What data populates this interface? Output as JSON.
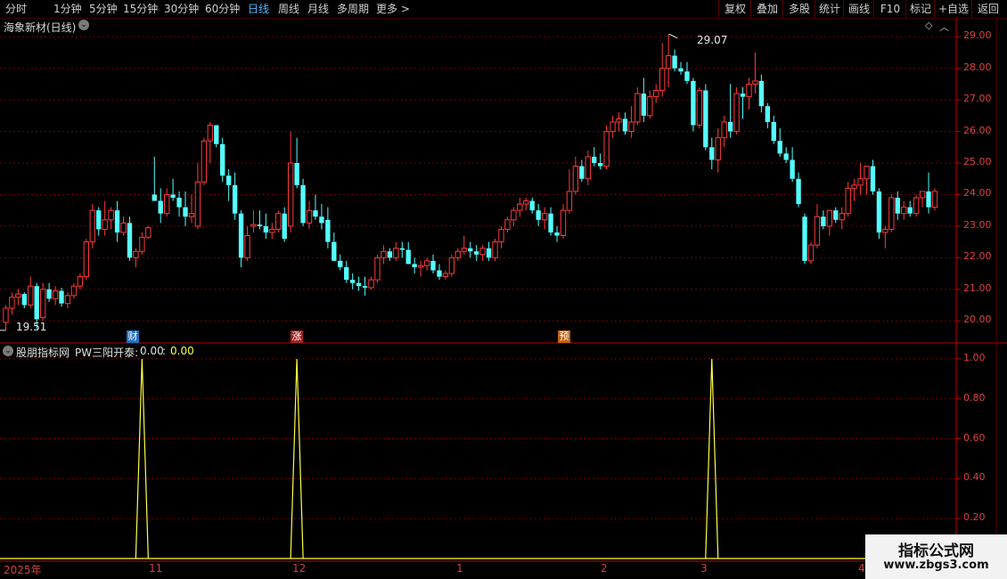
{
  "toolbar": {
    "periods": [
      "分时",
      "1分钟",
      "5分钟",
      "15分钟",
      "30分钟",
      "60分钟",
      "日线",
      "周线",
      "月线",
      "多周期",
      "更多 >"
    ],
    "selected_period": "日线",
    "actions": [
      "复权",
      "叠加",
      "多股",
      "统计",
      "画线",
      "F10",
      "标记",
      "+自选",
      "返回"
    ]
  },
  "main_chart": {
    "title": "海象新材(日线)",
    "high_label": "29.07",
    "low_label": "19.51",
    "markers": [
      "财",
      "涨",
      "预"
    ]
  },
  "indicator": {
    "name": "股朋指标网",
    "formula": "PW三阳开泰:",
    "value1": "0.00",
    "value2": "0.00"
  },
  "time_axis": [
    "2025年",
    "11",
    "12",
    "1",
    "2",
    "3",
    "4"
  ],
  "watermark": {
    "line1": "指标公式网",
    "line2": "www.zbgs3.com"
  },
  "chart_data": [
    {
      "type": "candlestick",
      "title": "海象新材(日线)",
      "ylim": [
        19.3,
        29.6
      ],
      "y_ticks": [
        20.0,
        21.0,
        22.0,
        23.0,
        24.0,
        25.0,
        26.0,
        27.0,
        28.0,
        29.0
      ],
      "up_color": "#ff3a3a",
      "down_color": "#54ffff",
      "candles": [
        [
          19.95,
          20.5,
          19.7,
          20.4
        ],
        [
          20.4,
          20.9,
          20.2,
          20.75
        ],
        [
          20.75,
          21.0,
          20.5,
          20.85
        ],
        [
          20.85,
          20.9,
          20.4,
          20.5
        ],
        [
          20.5,
          21.4,
          20.4,
          21.1
        ],
        [
          21.1,
          21.2,
          19.75,
          20.05
        ],
        [
          20.1,
          21.2,
          20.0,
          21.0
        ],
        [
          21.0,
          21.2,
          20.6,
          20.7
        ],
        [
          20.7,
          21.1,
          20.5,
          20.95
        ],
        [
          20.95,
          21.05,
          20.45,
          20.55
        ],
        [
          20.55,
          20.9,
          20.4,
          20.8
        ],
        [
          20.8,
          21.2,
          20.7,
          21.1
        ],
        [
          21.1,
          21.5,
          21.0,
          21.4
        ],
        [
          21.4,
          22.6,
          21.3,
          22.5
        ],
        [
          22.5,
          23.7,
          22.3,
          23.5
        ],
        [
          23.5,
          23.6,
          22.7,
          22.9
        ],
        [
          22.9,
          23.8,
          22.7,
          23.2
        ],
        [
          23.2,
          23.6,
          22.9,
          23.5
        ],
        [
          23.5,
          23.8,
          22.5,
          22.8
        ],
        [
          22.8,
          23.3,
          22.7,
          23.1
        ],
        [
          23.1,
          23.3,
          21.9,
          22.0
        ],
        [
          22.0,
          22.3,
          21.7,
          22.2
        ],
        [
          22.2,
          22.8,
          22.1,
          22.65
        ],
        [
          22.65,
          23.0,
          22.6,
          22.95
        ],
        [
          24.0,
          25.2,
          23.8,
          23.8
        ],
        [
          23.8,
          24.2,
          23.1,
          23.4
        ],
        [
          23.4,
          24.2,
          23.3,
          24.0
        ],
        [
          24.0,
          24.5,
          23.8,
          23.9
        ],
        [
          23.9,
          24.1,
          23.3,
          23.6
        ],
        [
          23.6,
          24.1,
          23.0,
          23.3
        ],
        [
          23.3,
          24.0,
          23.1,
          23.4
        ],
        [
          23.0,
          25.0,
          22.9,
          24.4
        ],
        [
          24.4,
          25.8,
          24.3,
          25.7
        ],
        [
          25.7,
          26.3,
          25.0,
          26.2
        ],
        [
          26.2,
          26.2,
          25.5,
          25.6
        ],
        [
          25.6,
          25.8,
          24.4,
          24.6
        ],
        [
          24.6,
          24.8,
          23.8,
          24.3
        ],
        [
          24.3,
          24.7,
          23.2,
          23.4
        ],
        [
          23.4,
          23.5,
          21.7,
          22.0
        ],
        [
          22.0,
          23.0,
          21.9,
          22.7
        ],
        [
          23.0,
          23.5,
          22.8,
          23.05
        ],
        [
          23.05,
          23.5,
          22.9,
          23.0
        ],
        [
          23.0,
          23.4,
          22.6,
          22.8
        ],
        [
          22.8,
          23.1,
          22.6,
          22.9
        ],
        [
          22.9,
          23.5,
          22.8,
          23.4
        ],
        [
          23.4,
          23.6,
          22.5,
          22.6
        ],
        [
          23.0,
          26.0,
          22.8,
          25.0
        ],
        [
          25.0,
          25.8,
          24.2,
          24.3
        ],
        [
          24.3,
          24.5,
          23.0,
          23.1
        ],
        [
          23.1,
          23.8,
          22.9,
          23.5
        ],
        [
          23.5,
          24.0,
          23.2,
          23.3
        ],
        [
          23.3,
          23.7,
          22.9,
          23.1
        ],
        [
          23.2,
          23.6,
          22.3,
          22.5
        ],
        [
          22.5,
          22.8,
          21.9,
          21.9
        ],
        [
          21.9,
          22.1,
          21.6,
          21.7
        ],
        [
          21.7,
          21.9,
          21.2,
          21.3
        ],
        [
          21.3,
          21.5,
          21.0,
          21.2
        ],
        [
          21.2,
          21.4,
          20.95,
          21.1
        ],
        [
          21.1,
          21.4,
          20.8,
          21.05
        ],
        [
          21.05,
          21.4,
          21.0,
          21.3
        ],
        [
          21.3,
          22.1,
          21.2,
          22.0
        ],
        [
          22.0,
          22.4,
          21.8,
          22.2
        ],
        [
          22.2,
          22.3,
          21.9,
          22.0
        ],
        [
          22.0,
          22.5,
          21.9,
          22.3
        ],
        [
          22.3,
          22.5,
          22.0,
          22.25
        ],
        [
          22.25,
          22.5,
          21.8,
          21.8
        ],
        [
          21.8,
          22.0,
          21.5,
          21.7
        ],
        [
          21.7,
          21.9,
          21.4,
          21.75
        ],
        [
          21.75,
          22.0,
          21.6,
          21.9
        ],
        [
          21.9,
          22.1,
          21.5,
          21.6
        ],
        [
          21.6,
          21.8,
          21.3,
          21.4
        ],
        [
          21.4,
          21.6,
          21.3,
          21.5
        ],
        [
          21.5,
          22.1,
          21.4,
          22.0
        ],
        [
          22.0,
          22.3,
          21.9,
          22.2
        ],
        [
          22.2,
          22.7,
          22.1,
          22.3
        ],
        [
          22.3,
          22.5,
          22.0,
          22.2
        ],
        [
          22.2,
          22.4,
          21.9,
          22.1
        ],
        [
          22.1,
          22.4,
          21.9,
          22.3
        ],
        [
          22.3,
          22.5,
          21.9,
          22.0
        ],
        [
          22.0,
          22.6,
          21.9,
          22.5
        ],
        [
          22.5,
          23.0,
          22.3,
          22.9
        ],
        [
          22.9,
          23.3,
          22.8,
          23.2
        ],
        [
          23.2,
          23.6,
          23.0,
          23.5
        ],
        [
          23.5,
          23.9,
          23.3,
          23.7
        ],
        [
          23.7,
          23.9,
          23.5,
          23.8
        ],
        [
          23.8,
          23.9,
          23.4,
          23.5
        ],
        [
          23.5,
          23.7,
          23.0,
          23.2
        ],
        [
          23.2,
          23.6,
          22.9,
          23.4
        ],
        [
          23.4,
          23.6,
          22.7,
          22.8
        ],
        [
          22.8,
          23.0,
          22.5,
          22.7
        ],
        [
          22.7,
          23.7,
          22.6,
          23.5
        ],
        [
          23.5,
          24.8,
          23.4,
          24.1
        ],
        [
          24.1,
          25.2,
          24.0,
          24.9
        ],
        [
          24.9,
          25.1,
          24.4,
          24.5
        ],
        [
          24.5,
          25.4,
          24.3,
          25.2
        ],
        [
          25.2,
          25.5,
          24.9,
          25.0
        ],
        [
          25.0,
          25.3,
          24.8,
          24.9
        ],
        [
          24.9,
          26.2,
          24.8,
          26.0
        ],
        [
          26.0,
          26.5,
          25.8,
          26.3
        ],
        [
          26.3,
          26.6,
          26.0,
          26.4
        ],
        [
          26.4,
          26.6,
          25.9,
          26.0
        ],
        [
          26.0,
          26.8,
          25.8,
          26.3
        ],
        [
          26.3,
          27.4,
          26.2,
          27.2
        ],
        [
          27.2,
          27.7,
          26.3,
          26.5
        ],
        [
          26.5,
          27.3,
          26.4,
          27.1
        ],
        [
          27.1,
          27.5,
          26.9,
          27.3
        ],
        [
          27.3,
          28.8,
          27.1,
          28.0
        ],
        [
          28.0,
          29.07,
          27.4,
          28.4
        ],
        [
          28.4,
          28.6,
          27.9,
          28.0
        ],
        [
          28.0,
          28.2,
          27.8,
          27.9
        ],
        [
          27.9,
          28.2,
          27.5,
          27.6
        ],
        [
          27.6,
          27.7,
          26.0,
          26.2
        ],
        [
          26.2,
          27.4,
          26.1,
          27.3
        ],
        [
          27.3,
          27.5,
          25.4,
          25.5
        ],
        [
          25.5,
          25.8,
          24.8,
          25.1
        ],
        [
          25.1,
          26.1,
          24.7,
          25.8
        ],
        [
          25.8,
          26.5,
          25.5,
          26.3
        ],
        [
          26.3,
          27.5,
          25.8,
          26.0
        ],
        [
          26.0,
          27.4,
          25.9,
          27.2
        ],
        [
          27.2,
          27.4,
          26.4,
          27.1
        ],
        [
          27.1,
          27.7,
          26.7,
          27.5
        ],
        [
          27.5,
          28.5,
          27.2,
          27.6
        ],
        [
          27.6,
          27.8,
          26.6,
          26.8
        ],
        [
          26.8,
          26.9,
          26.1,
          26.3
        ],
        [
          26.3,
          26.5,
          25.6,
          25.7
        ],
        [
          25.7,
          26.1,
          25.2,
          25.3
        ],
        [
          25.3,
          25.5,
          25.0,
          25.1
        ],
        [
          25.1,
          25.5,
          24.4,
          24.5
        ],
        [
          24.5,
          24.7,
          23.6,
          23.7
        ],
        [
          23.3,
          23.4,
          21.8,
          21.9
        ],
        [
          21.9,
          22.5,
          21.8,
          22.4
        ],
        [
          22.4,
          23.7,
          22.3,
          23.3
        ],
        [
          23.3,
          23.5,
          22.9,
          23.0
        ],
        [
          23.0,
          23.5,
          22.7,
          23.5
        ],
        [
          23.5,
          23.6,
          23.1,
          23.2
        ],
        [
          23.2,
          23.6,
          22.9,
          23.4
        ],
        [
          23.4,
          24.4,
          23.3,
          24.2
        ],
        [
          24.2,
          24.5,
          23.8,
          24.3
        ],
        [
          24.3,
          25.0,
          24.0,
          24.5
        ],
        [
          24.5,
          24.7,
          24.0,
          24.9
        ],
        [
          24.9,
          25.1,
          24.0,
          24.1
        ],
        [
          24.1,
          24.2,
          22.6,
          22.8
        ],
        [
          22.8,
          23.0,
          22.3,
          22.9
        ],
        [
          22.9,
          24.0,
          22.8,
          23.9
        ],
        [
          23.9,
          24.1,
          23.2,
          23.4
        ],
        [
          23.4,
          23.8,
          23.2,
          23.6
        ],
        [
          23.6,
          23.8,
          23.3,
          23.4
        ],
        [
          23.4,
          24.0,
          23.3,
          23.9
        ],
        [
          23.9,
          24.0,
          23.6,
          24.1
        ],
        [
          24.1,
          24.7,
          23.4,
          23.6
        ],
        [
          23.6,
          24.2,
          23.5,
          24.1
        ]
      ]
    },
    {
      "type": "line",
      "title": "PW三阳开泰",
      "ylim": [
        0,
        1.08
      ],
      "y_ticks": [
        0.2,
        0.4,
        0.6,
        0.8,
        1.0
      ],
      "series": [
        {
          "color": "#ffff40",
          "spikes_at_candle_index": [
            22,
            47,
            114
          ],
          "values_at_spikes": [
            1.0,
            1.0,
            1.0
          ]
        }
      ]
    }
  ]
}
